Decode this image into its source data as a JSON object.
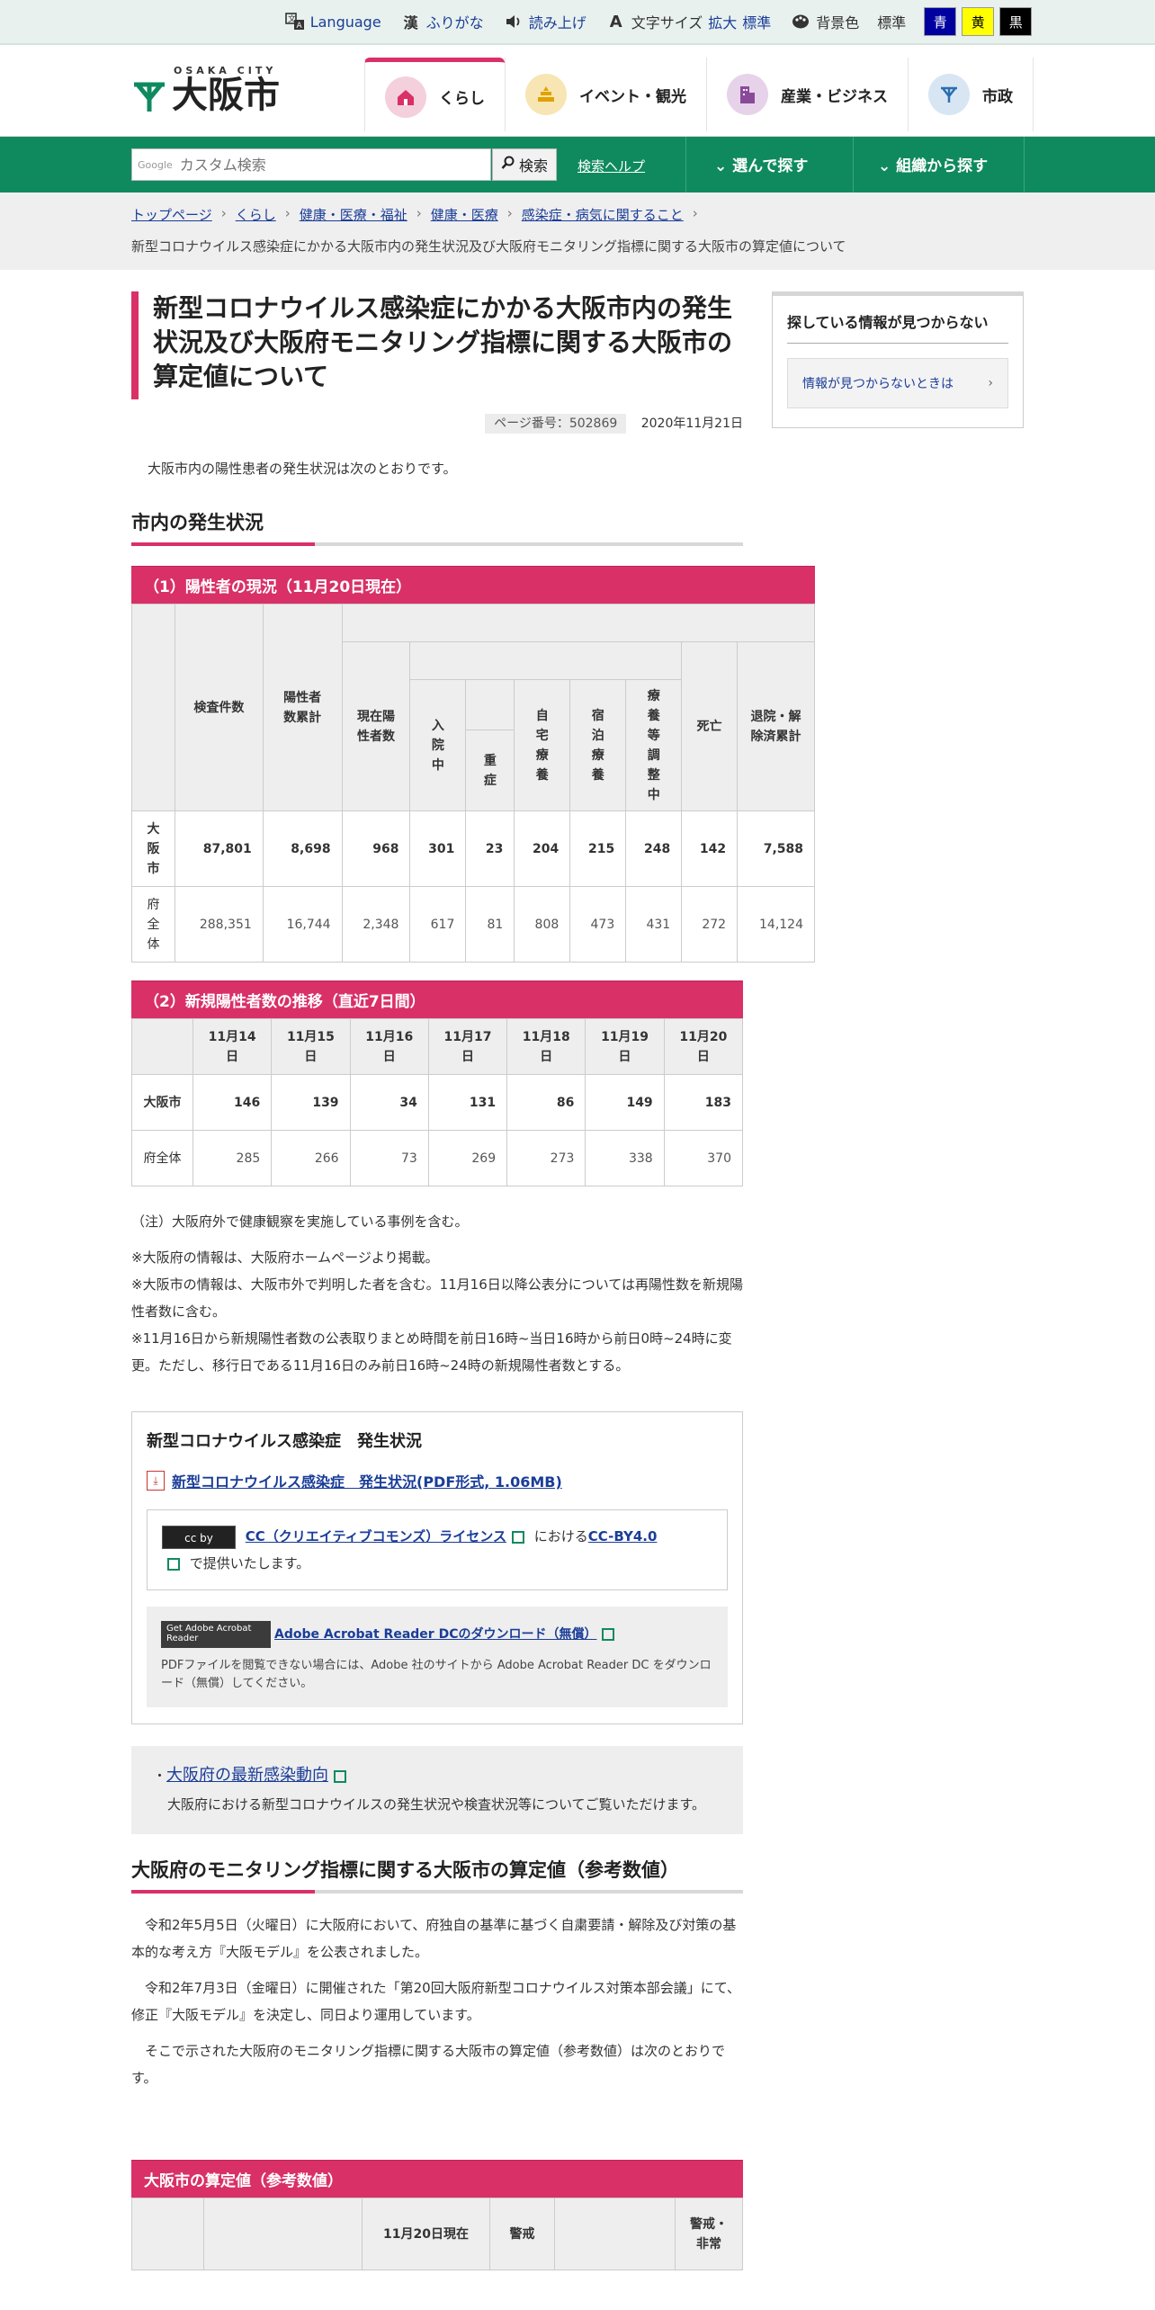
{
  "utility": {
    "language": "Language",
    "furigana": "ふりがな",
    "readaloud": "読み上げ",
    "fontsize_label": "文字サイズ",
    "fontsize_large": "拡大",
    "fontsize_standard": "標準",
    "bgcolor_label": "背景色",
    "bg_standard": "標準",
    "bg_blue": "青",
    "bg_yellow": "黄",
    "bg_black": "黒",
    "colors": {
      "blue": "#0000a0",
      "yellow": "#ffff00",
      "black": "#000000"
    }
  },
  "header": {
    "logo_en": "OSAKA CITY",
    "logo_jp": "大阪市",
    "nav": [
      {
        "label": "くらし",
        "icon": "house-icon",
        "color": "#f3d0dc"
      },
      {
        "label": "イベント・観光",
        "icon": "event-icon",
        "color": "#f7e6b3"
      },
      {
        "label": "産業・ビジネス",
        "icon": "building-icon",
        "color": "#e6d3ea"
      },
      {
        "label": "市政",
        "icon": "city-emblem-icon",
        "color": "#d8e6f3"
      }
    ]
  },
  "search": {
    "google": "Google",
    "placeholder": "カスタム検索",
    "button": "検索",
    "help": "検索ヘルプ",
    "choose": "選んで探す",
    "org": "組織から探す"
  },
  "breadcrumb": {
    "items": [
      "トップページ",
      "くらし",
      "健康・医療・福祉",
      "健康・医療",
      "感染症・病気に関すること"
    ],
    "current": "新型コロナウイルス感染症にかかる大阪市内の発生状況及び大阪府モニタリング指標に関する大阪市の算定値について"
  },
  "page": {
    "title": "新型コロナウイルス感染症にかかる大阪市内の発生状況及び大阪府モニタリング指標に関する大阪市の算定値について",
    "page_number": "ページ番号：502869",
    "date": "2020年11月21日",
    "intro": "大阪市内の陽性患者の発生状況は次のとおりです。",
    "section1": "市内の発生状況"
  },
  "table1": {
    "caption": "（1）陽性者の現況（11月20日現在）",
    "headers": {
      "tests": "検査件数",
      "positive_total": "陽性者数累計",
      "current": "現在陽性者数",
      "hospitalized": "入院中",
      "severe": "重症",
      "home": "自宅療養",
      "hotel": "宿泊療養",
      "adjusting": "療養等調整中",
      "deaths": "死亡",
      "discharged": "退院・解除済累計"
    },
    "rows": [
      {
        "label": "大阪市",
        "values": [
          "87,801",
          "8,698",
          "968",
          "301",
          "23",
          "204",
          "215",
          "248",
          "142",
          "7,588"
        ]
      },
      {
        "label": "府全体",
        "values": [
          "288,351",
          "16,744",
          "2,348",
          "617",
          "81",
          "808",
          "473",
          "431",
          "272",
          "14,124"
        ]
      }
    ]
  },
  "table2": {
    "caption": "（2）新規陽性者数の推移（直近7日間）",
    "dates": [
      "11月14日",
      "11月15日",
      "11月16日",
      "11月17日",
      "11月18日",
      "11月19日",
      "11月20日"
    ],
    "rows": [
      {
        "label": "大阪市",
        "values": [
          "146",
          "139",
          "34",
          "131",
          "86",
          "149",
          "183"
        ]
      },
      {
        "label": "府全体",
        "values": [
          "285",
          "266",
          "73",
          "269",
          "273",
          "338",
          "370"
        ]
      }
    ]
  },
  "notes": {
    "note1": "（注）大阪府外で健康観察を実施している事例を含む。",
    "note2": "※大阪府の情報は、大阪府ホームページより掲載。",
    "note3": "※大阪市の情報は、大阪市外で判明した者を含む。11月16日以降公表分については再陽性数を新規陽性者数に含む。",
    "note4": "※11月16日から新規陽性者数の公表取りまとめ時間を前日16時~当日16時から前日0時~24時に変更。ただし、移行日である11月16日のみ前日16時~24時の新規陽性者数とする。"
  },
  "pdf": {
    "heading": "新型コロナウイルス感染症　発生状況",
    "link": "新型コロナウイルス感染症　発生状況(PDF形式, 1.06MB)",
    "cc_badge": "cc by",
    "cc_link": "CC（クリエイティブコモンズ）ライセンス",
    "cc_mid": "における",
    "cc_by": "CC-BY4.0",
    "cc_end": "で提供いたします。",
    "acro_badge": "Get Adobe Acrobat Reader",
    "acro_link": "Adobe Acrobat Reader DCのダウンロード（無償）",
    "acro_text": "PDFファイルを閲覧できない場合には、Adobe 社のサイトから Adobe Acrobat Reader DC をダウンロード（無償）してください。"
  },
  "related": {
    "link": "大阪府の最新感染動向",
    "text": "大阪府における新型コロナウイルスの発生状況や検査状況等についてご覧いただけます。"
  },
  "section2": {
    "heading": "大阪府のモニタリング指標に関する大阪市の算定値（参考数値）",
    "p1": "令和2年5月5日（火曜日）に大阪府において、府独自の基準に基づく自粛要請・解除及び対策の基本的な考え方『大阪モデル』を公表されました。",
    "p2": "令和2年7月3日（金曜日）に開催された「第20回大阪府新型コロナウイルス対策本部会議」にて、修正『大阪モデル』を決定し、同日より運用しています。",
    "p3": "そこで示された大阪府のモニタリング指標に関する大阪市の算定値（参考数値）は次のとおりです。",
    "table_caption": "大阪市の算定値（参考数値）",
    "col_date": "11月20日現在",
    "col_vigilance": "警戒",
    "col_alert": "警戒・非常"
  },
  "sidebar": {
    "heading": "探している情報が見つからない",
    "link": "情報が見つからないときは"
  }
}
